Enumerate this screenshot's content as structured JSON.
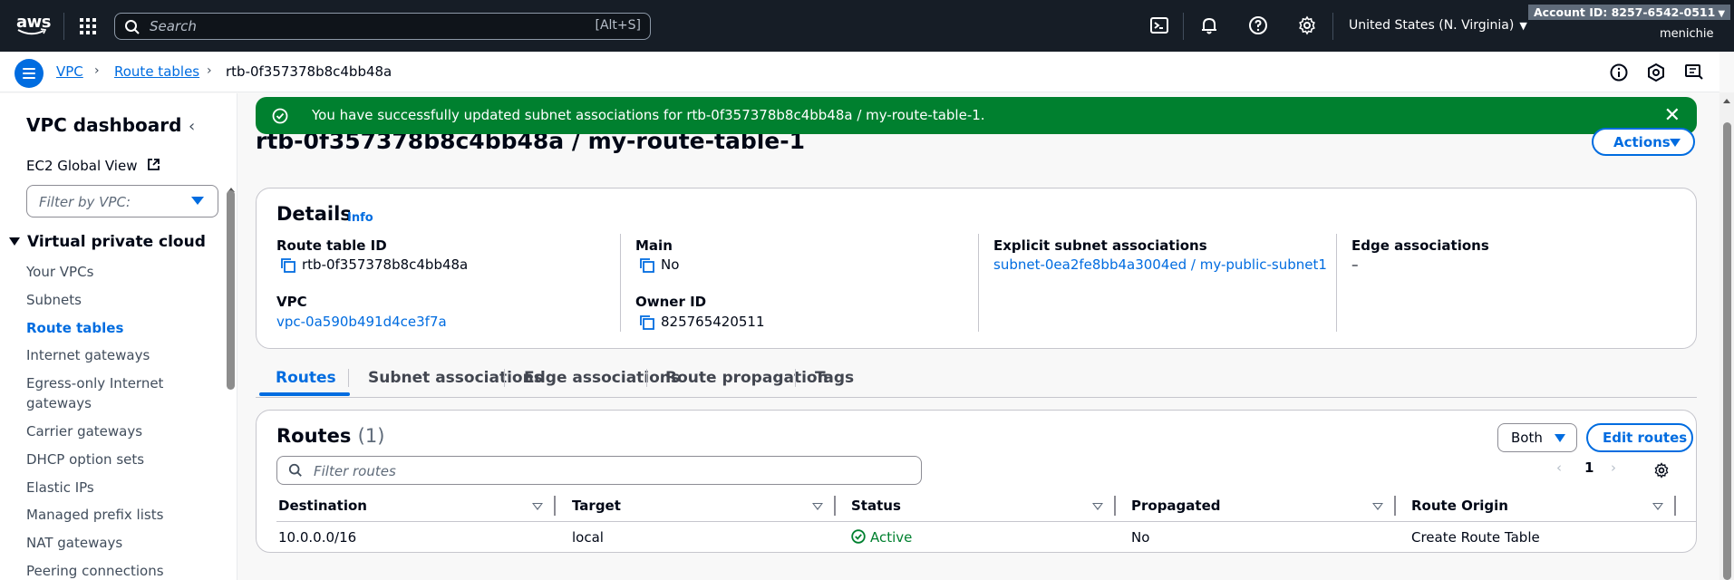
{
  "topnav": {
    "logo_text": "aws",
    "search_placeholder": "Search",
    "search_shortcut": "[Alt+S]",
    "region": "United States (N. Virginia)",
    "account_label": "Account ID: 8257-6542-0511",
    "username": "menichie"
  },
  "breadcrumb": {
    "items": [
      "VPC",
      "Route tables",
      "rtb-0f357378b8c4bb48a"
    ]
  },
  "sidebar": {
    "title": "VPC dashboard",
    "ec2_global_view": "EC2 Global View",
    "filter_placeholder": "Filter by VPC:",
    "section": "Virtual private cloud",
    "items": [
      {
        "label": "Your VPCs"
      },
      {
        "label": "Subnets"
      },
      {
        "label": "Route tables"
      },
      {
        "label": "Internet gateways"
      },
      {
        "label": "Egress-only Internet gateways"
      },
      {
        "label": "Carrier gateways"
      },
      {
        "label": "DHCP option sets"
      },
      {
        "label": "Elastic IPs"
      },
      {
        "label": "Managed prefix lists"
      },
      {
        "label": "NAT gateways"
      },
      {
        "label": "Peering connections"
      }
    ],
    "active_item": "Route tables"
  },
  "flash": {
    "message": "You have successfully updated subnet associations for rtb-0f357378b8c4bb48a / my-route-table-1.",
    "color": "#00802f"
  },
  "page": {
    "title": "rtb-0f357378b8c4bb48a / my-route-table-1",
    "actions_label": "Actions"
  },
  "details": {
    "title": "Details",
    "info": "Info",
    "route_table_id_label": "Route table ID",
    "route_table_id": "rtb-0f357378b8c4bb48a",
    "vpc_label": "VPC",
    "vpc": "vpc-0a590b491d4ce3f7a",
    "main_label": "Main",
    "main": "No",
    "owner_label": "Owner ID",
    "owner": "825765420511",
    "explicit_label": "Explicit subnet associations",
    "explicit": "subnet-0ea2fe8bb4a3004ed / my-public-subnet1",
    "edge_label": "Edge associations",
    "edge": "–"
  },
  "tabs": [
    {
      "label": "Routes"
    },
    {
      "label": "Subnet associations"
    },
    {
      "label": "Edge associations"
    },
    {
      "label": "Route propagation"
    },
    {
      "label": "Tags"
    }
  ],
  "active_tab": "Routes",
  "routes": {
    "title": "Routes",
    "count": "(1)",
    "filter_placeholder": "Filter routes",
    "both_label": "Both",
    "edit_label": "Edit routes",
    "page": "1",
    "columns": [
      "Destination",
      "Target",
      "Status",
      "Propagated",
      "Route Origin"
    ],
    "rows": [
      {
        "destination": "10.0.0.0/16",
        "target": "local",
        "status": "Active",
        "propagated": "No",
        "origin": "Create Route Table"
      }
    ]
  },
  "colors": {
    "accent": "#006ce0",
    "success": "#00802f",
    "nav_bg": "#161d26"
  }
}
